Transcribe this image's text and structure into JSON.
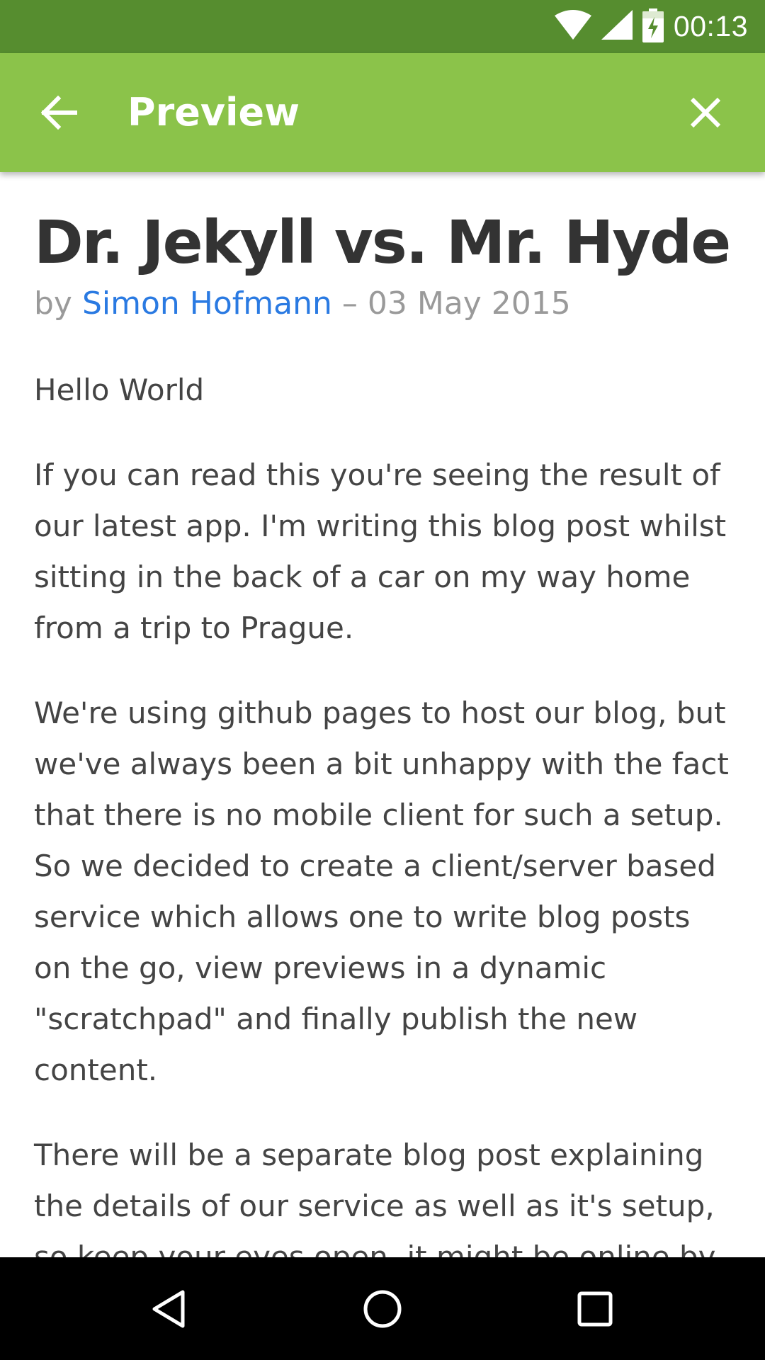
{
  "status_bar": {
    "time": "00:13",
    "icons": [
      "wifi-icon",
      "cell-signal-icon",
      "battery-charging-icon"
    ],
    "color": "#568d2f"
  },
  "app_bar": {
    "title": "Preview",
    "back_icon": "arrow-left-icon",
    "close_icon": "close-icon",
    "color": "#8bc34a"
  },
  "post": {
    "title": "Dr. Jekyll vs. Mr. Hyde",
    "by_label": "by",
    "author": "Simon Hofmann",
    "separator": "–",
    "date": "03 May 2015",
    "author_color": "#2a7ae2",
    "paragraphs": [
      "Hello World",
      "If you can read this you're seeing the result of our latest app. I'm writing this blog post whilst sitting in the back of a car on my way home from a trip to Prague.",
      "We're using github pages to host our blog, but we've always been a bit unhappy with the fact that there is no mobile client for such a setup. So we decided to create a client/server based service which allows one to write blog posts on the go, view previews in a dynamic \"scratchpad\" and finally publish the new content.",
      "There will be a separate blog post explaining the details of our service as well as it's setup, so keep your eyes open, it might be online by"
    ]
  },
  "nav_bar": {
    "icons": [
      "back-triangle-icon",
      "home-circle-icon",
      "recents-square-icon"
    ]
  }
}
